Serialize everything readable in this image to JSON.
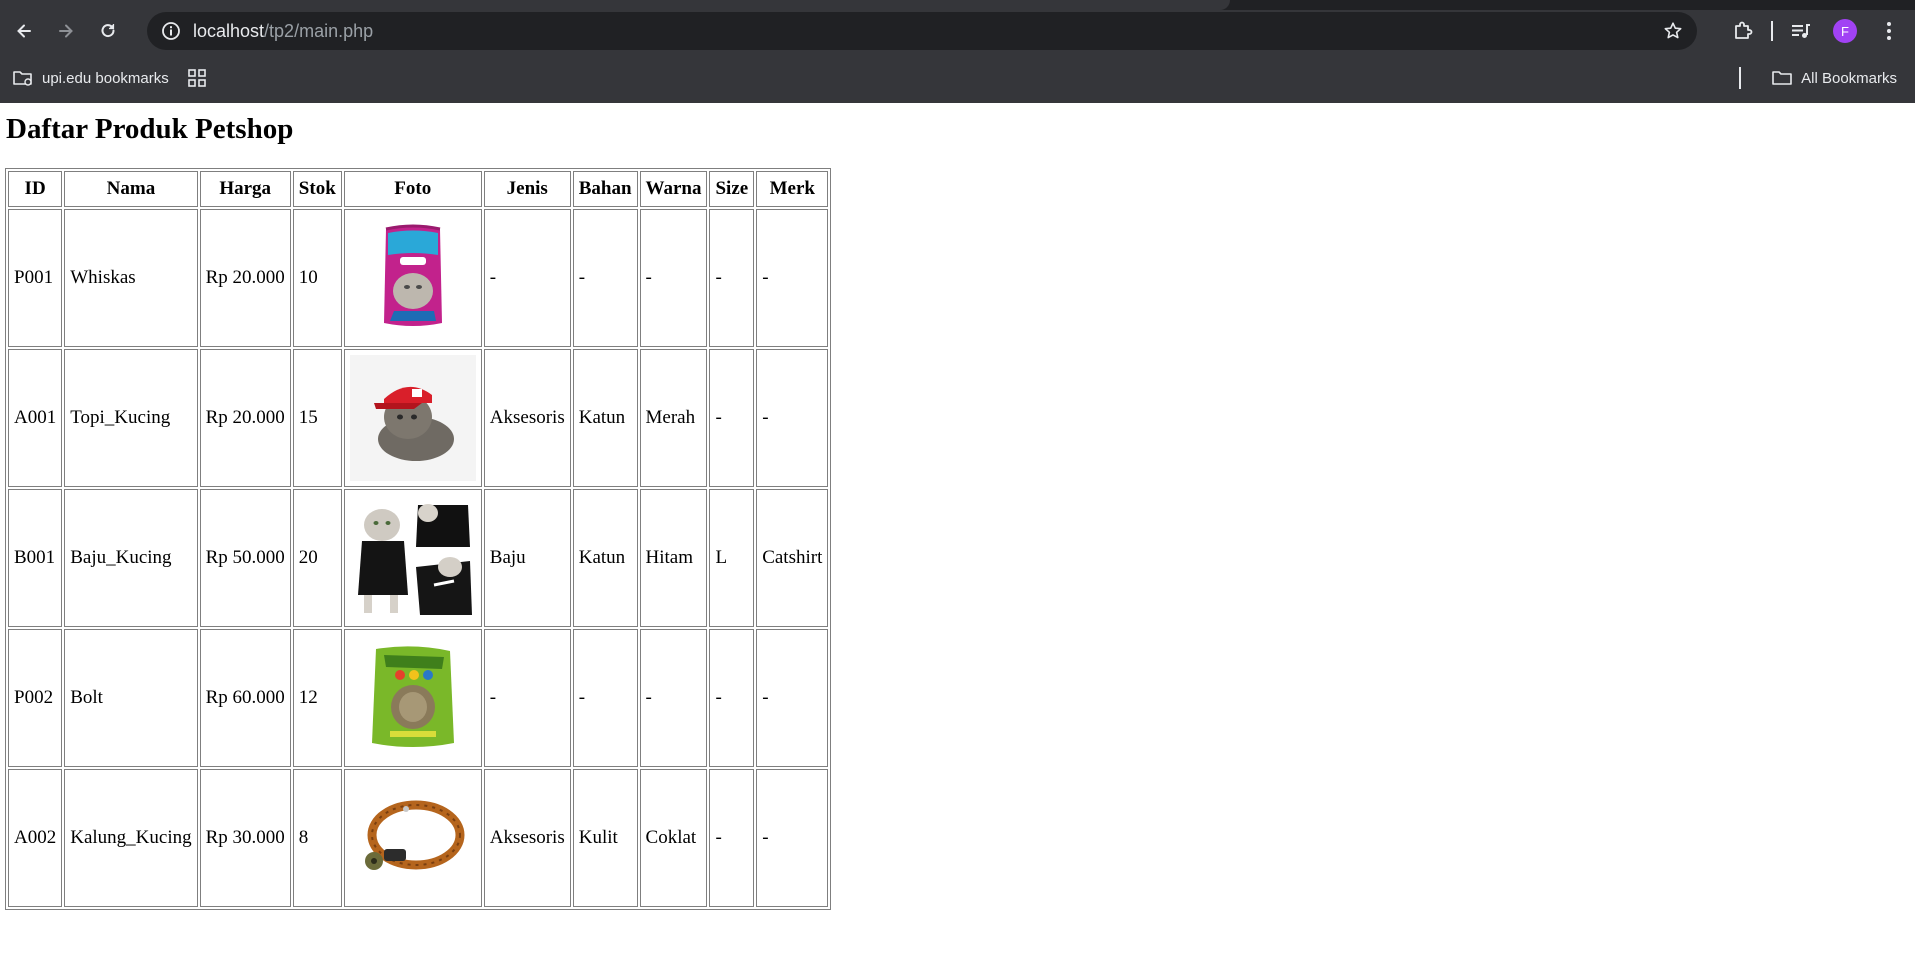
{
  "browser": {
    "url_host": "localhost",
    "url_path": "/tp2/main.php",
    "profile_initial": "F",
    "bookmarks": {
      "left_label": "upi.edu bookmarks",
      "right_label": "All Bookmarks"
    }
  },
  "page": {
    "title": "Daftar Produk Petshop"
  },
  "table": {
    "headers": [
      "ID",
      "Nama",
      "Harga",
      "Stok",
      "Foto",
      "Jenis",
      "Bahan",
      "Warna",
      "Size",
      "Merk"
    ],
    "rows": [
      {
        "id": "P001",
        "nama": "Whiskas",
        "harga": "Rp 20.000",
        "stok": "10",
        "foto": "whiskas-bag",
        "jenis": "-",
        "bahan": "-",
        "warna": "-",
        "size": "-",
        "merk": "-"
      },
      {
        "id": "A001",
        "nama": "Topi_Kucing",
        "harga": "Rp 20.000",
        "stok": "15",
        "foto": "cat-with-red-cap",
        "jenis": "Aksesoris",
        "bahan": "Katun",
        "warna": "Merah",
        "size": "-",
        "merk": "-"
      },
      {
        "id": "B001",
        "nama": "Baju_Kucing",
        "harga": "Rp 50.000",
        "stok": "20",
        "foto": "cat-in-black-shirt",
        "jenis": "Baju",
        "bahan": "Katun",
        "warna": "Hitam",
        "size": "L",
        "merk": "Catshirt"
      },
      {
        "id": "P002",
        "nama": "Bolt",
        "harga": "Rp 60.000",
        "stok": "12",
        "foto": "bolt-food-bag",
        "jenis": "-",
        "bahan": "-",
        "warna": "-",
        "size": "-",
        "merk": "-"
      },
      {
        "id": "A002",
        "nama": "Kalung_Kucing",
        "harga": "Rp 30.000",
        "stok": "8",
        "foto": "cat-collar",
        "jenis": "Aksesoris",
        "bahan": "Kulit",
        "warna": "Coklat",
        "size": "-",
        "merk": "-"
      }
    ]
  },
  "colors": {
    "chrome_bg": "#35363a",
    "omnibox_bg": "#202124",
    "avatar_bg": "#a142f4",
    "table_border": "#7f7f7f"
  }
}
